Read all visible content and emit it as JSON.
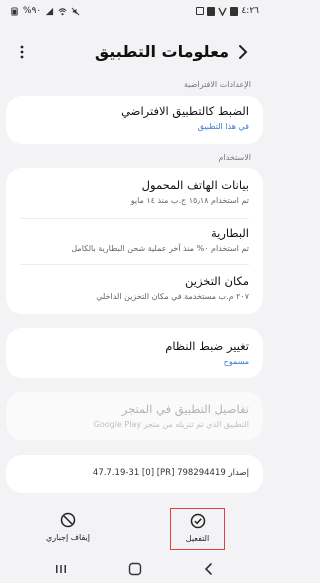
{
  "status_bar": {
    "time": "٤:٢٦",
    "battery": "%٩٠"
  },
  "header": {
    "title": "معلومات التطبيق",
    "back_icon": "back-arrow-icon",
    "more_icon": "more-vertical-icon"
  },
  "sections": {
    "defaults_label": "الإعدادات الافتراضية",
    "usage_label": "الاستخدام"
  },
  "defaults_card": {
    "title": "الضبط كالتطبيق الافتراضي",
    "subtitle": "في هذا التطبيق"
  },
  "usage_card": {
    "items": [
      {
        "title": "بيانات الهاتف المحمول",
        "subtitle": "تم استخدام ١٥٫١٨ ج.ب منذ ١٤ مايو"
      },
      {
        "title": "البطارية",
        "subtitle": "تم استخدام ٠% منذ آخر عملية شحن البطارية بالكامل"
      },
      {
        "title": "مكان التخزين",
        "subtitle": "٢٠٧ م.ب مستخدمة في مكان التخزين الداخلي"
      }
    ]
  },
  "system_card": {
    "title": "تغيير ضبط النظام",
    "subtitle": "مسموح"
  },
  "store_card": {
    "title": "تفاصيل التطبيق في المتجر",
    "subtitle": "التطبيق الذي تم تنزيله من متجر Google Play"
  },
  "version": {
    "text": "إصدار 798294419 [PR] [0] 47.7.19-31"
  },
  "bottom_actions": {
    "force_stop_label": "إيقاف إجباري",
    "enable_label": "التفعيل"
  },
  "colors": {
    "accent_blue": "#3e79d6",
    "highlight_red": "#e24040",
    "background": "#f3f3f6"
  }
}
